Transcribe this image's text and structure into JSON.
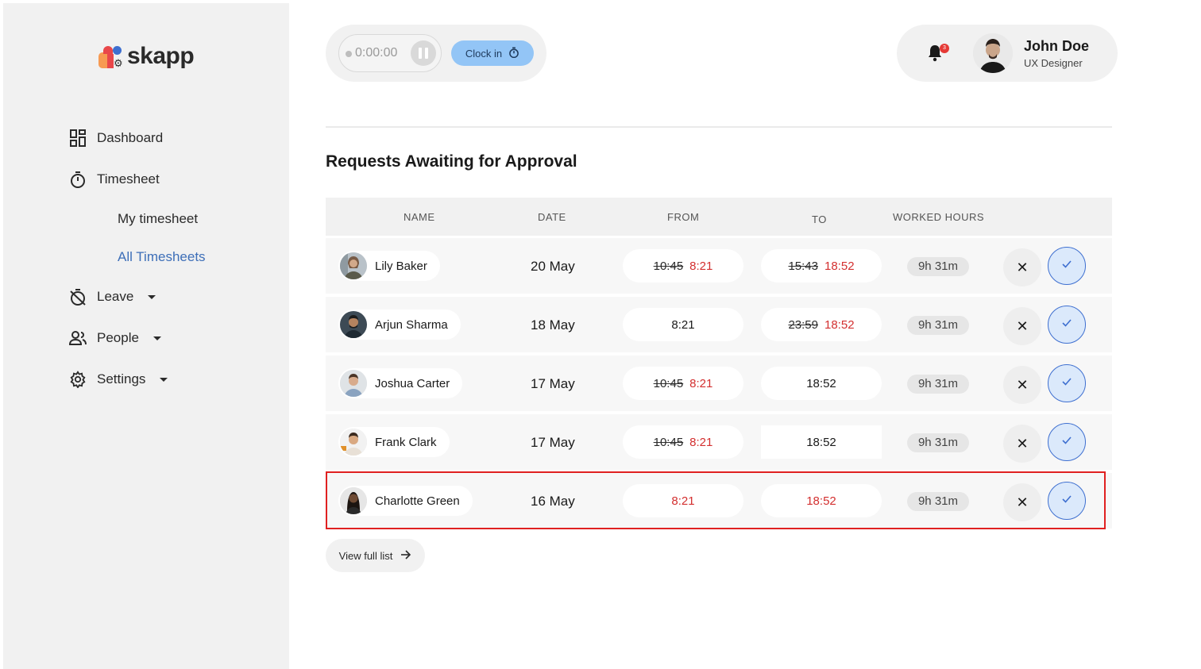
{
  "app": {
    "name": "skapp"
  },
  "sidebar": {
    "items": [
      {
        "label": "Dashboard",
        "icon": "dashboard-icon"
      },
      {
        "label": "Timesheet",
        "icon": "stopwatch-icon"
      },
      {
        "label": "Leave",
        "icon": "leave-icon"
      },
      {
        "label": "People",
        "icon": "people-icon"
      },
      {
        "label": "Settings",
        "icon": "gear-icon"
      }
    ],
    "timesheet_sub": [
      "My timesheet",
      "All Timesheets"
    ],
    "active_sub": "All Timesheets"
  },
  "header": {
    "timer": "0:00:00",
    "clock_in_label": "Clock in",
    "notification_count": "3",
    "user": {
      "name": "John Doe",
      "role": "UX Designer"
    }
  },
  "main": {
    "title": "Requests Awaiting for Approval",
    "columns": [
      "NAME",
      "DATE",
      "FROM",
      "TO",
      "WORKED HOURS"
    ],
    "rows": [
      {
        "name": "Lily Baker",
        "date": "20 May",
        "from_old": "10:45",
        "from_new": "8:21",
        "to_old": "15:43",
        "to_new": "18:52",
        "hours": "9h 31m"
      },
      {
        "name": "Arjun Sharma",
        "date": "18 May",
        "from_old": "",
        "from_new": "8:21",
        "to_old": "23:59",
        "to_new": "18:52",
        "hours": "9h 31m"
      },
      {
        "name": "Joshua Carter",
        "date": "17 May",
        "from_old": "10:45",
        "from_new": "8:21",
        "to_old": "",
        "to_new": "18:52",
        "hours": "9h 31m"
      },
      {
        "name": "Frank Clark",
        "date": "17 May",
        "from_old": "10:45",
        "from_new": "8:21",
        "to_old": "",
        "to_new": "18:52",
        "hours": "9h 31m"
      },
      {
        "name": "Charlotte Green",
        "date": "16 May",
        "from_old": "",
        "from_new": "8:21",
        "to_old": "",
        "to_new": "18:52",
        "hours": "9h 31m"
      }
    ],
    "view_full_list": "View full list"
  },
  "colors": {
    "accent": "#3e6fd0",
    "clock_in": "#93c5f6",
    "changed_time": "#d32f2f",
    "highlight_border": "#e02020"
  }
}
